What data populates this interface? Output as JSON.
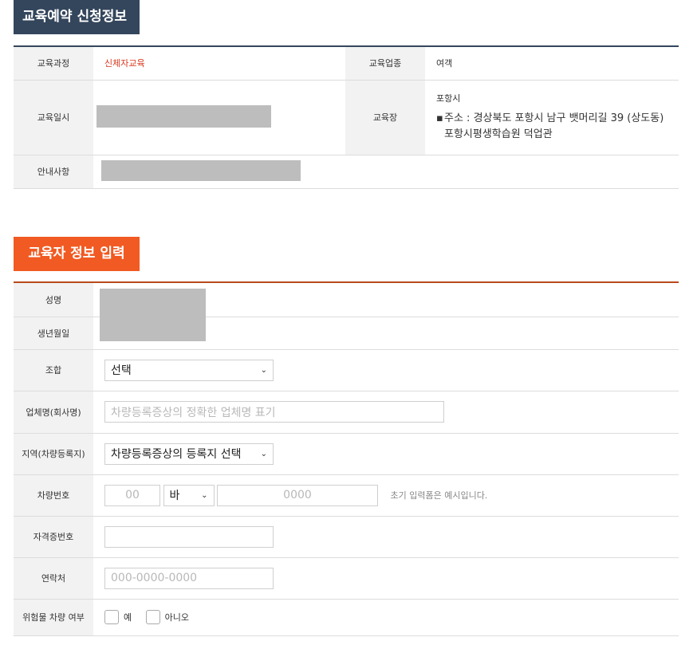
{
  "section1": {
    "title": "교육예약 신청정보",
    "rows": {
      "course_label": "교육과정",
      "course_value": "신체자교육",
      "industry_label": "교육업종",
      "industry_value": "여객",
      "datetime_label": "교육일시",
      "venue_label": "교육장",
      "venue_city": "포항시",
      "venue_address_prefix": "▪",
      "venue_address_line1": "주소 : 경상북도 포항시 남구 뱃머리길 39 (상도동)",
      "venue_address_line2": "포항시평생학습원 덕업관",
      "notice_label": "안내사항"
    }
  },
  "section2": {
    "title": "교육자 정보 입력",
    "name_label": "성명",
    "birth_label": "생년월일",
    "union_label": "조합",
    "union_selected": "선택",
    "company_label": "업체명(회사명)",
    "company_placeholder": "차량등록증상의 정확한 업체명 표기",
    "region_label": "지역(차량등록지)",
    "region_selected": "차량등록증상의 등록지 선택",
    "vehicle_label": "차량번호",
    "vehicle_part1_placeholder": "00",
    "vehicle_part2_selected": "바",
    "vehicle_part3_placeholder": "0000",
    "vehicle_hint": "초기 입력폼은 예시입니다.",
    "license_label": "자격증번호",
    "license_value": "",
    "phone_label": "연락처",
    "phone_placeholder": "000-0000-0000",
    "hazard_label": "위험물 차량 여부",
    "hazard_yes": "예",
    "hazard_no": "아니오"
  },
  "icons": {
    "select_arrow": "chevron-down-icon"
  }
}
